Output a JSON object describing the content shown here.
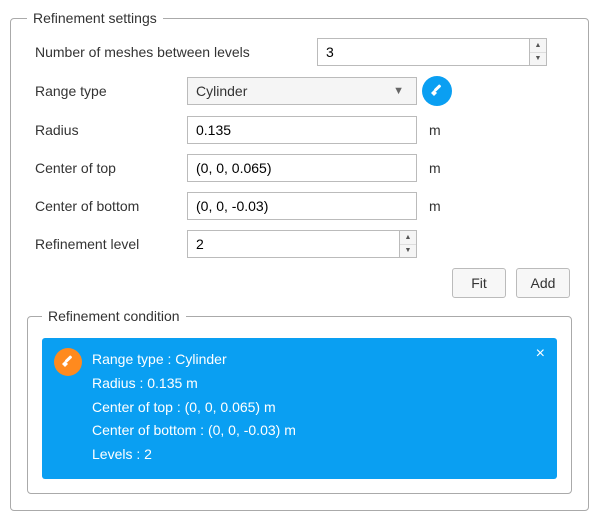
{
  "settings": {
    "legend": "Refinement settings",
    "meshes_label": "Number of meshes between levels",
    "meshes_value": "3",
    "range_type_label": "Range type",
    "range_type_value": "Cylinder",
    "radius_label": "Radius",
    "radius_value": "0.135",
    "radius_unit": "m",
    "center_top_label": "Center of top",
    "center_top_value": "(0, 0, 0.065)",
    "center_top_unit": "m",
    "center_bottom_label": "Center of bottom",
    "center_bottom_value": "(0, 0, -0.03)",
    "center_bottom_unit": "m",
    "level_label": "Refinement level",
    "level_value": "2",
    "fit_label": "Fit",
    "add_label": "Add"
  },
  "condition": {
    "legend": "Refinement condition",
    "line1": "Range type : Cylinder",
    "line2": "Radius : 0.135 m",
    "line3": "Center of top : (0, 0, 0.065) m",
    "line4": "Center of bottom : (0, 0, -0.03) m",
    "line5": "Levels : 2"
  }
}
